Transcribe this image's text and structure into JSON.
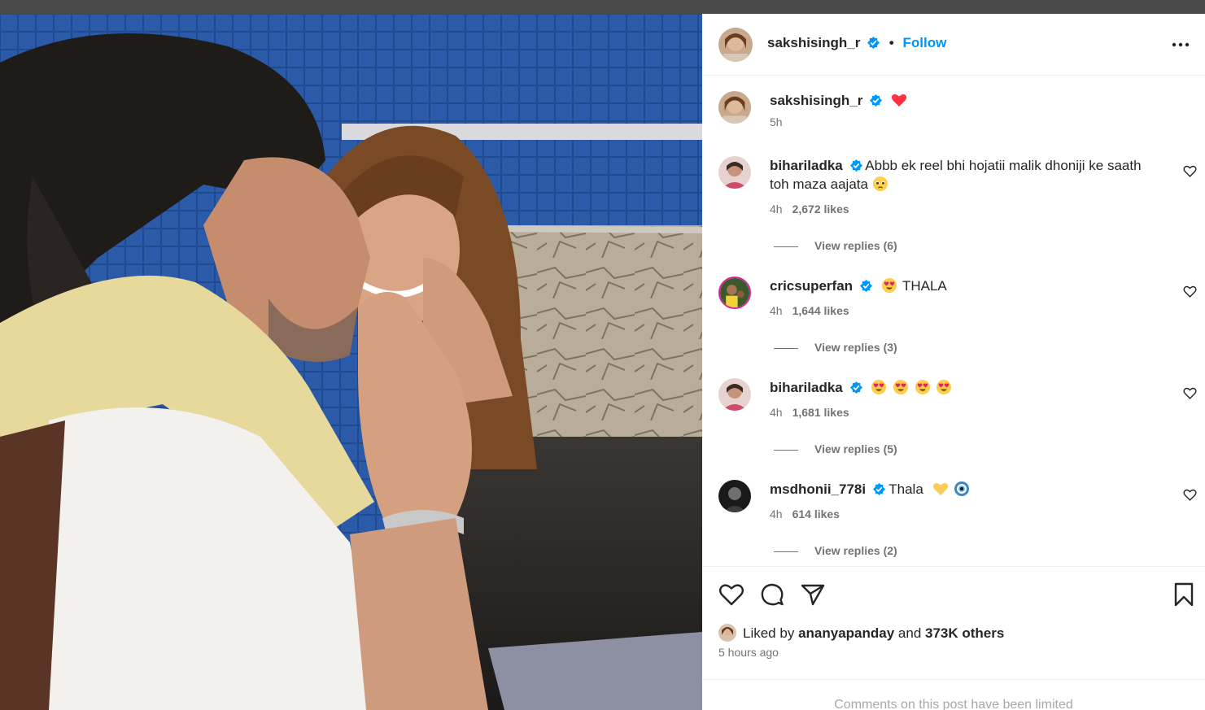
{
  "post": {
    "author": "sakshisingh_r",
    "follow_label": "Follow",
    "caption_time": "5h",
    "likes_prefix": "Liked by",
    "liked_by_user": "ananyapanday",
    "likes_mid": "and",
    "likes_others": "373K others",
    "time_ago": "5 hours ago",
    "comments_limited": "Comments on this post have been limited"
  },
  "comments": [
    {
      "user": "bihariladka",
      "text": "Abbb ek reel bhi hojatii malik dhoniji ke saath toh maza aajata",
      "time": "4h",
      "likes": "2,672 likes",
      "replies": "View replies (6)"
    },
    {
      "user": "cricsuperfan",
      "text": "THALA",
      "time": "4h",
      "likes": "1,644 likes",
      "replies": "View replies (3)"
    },
    {
      "user": "bihariladka",
      "text": "",
      "time": "4h",
      "likes": "1,681 likes",
      "replies": "View replies (5)"
    },
    {
      "user": "msdhonii_778i",
      "text": "Thala",
      "time": "4h",
      "likes": "614 likes",
      "replies": "View replies (2)"
    }
  ],
  "icons": {
    "more": "more-options-icon",
    "like": "heart-icon",
    "comment": "comment-icon",
    "share": "send-icon",
    "save": "bookmark-icon",
    "verified": "verified-badge-icon"
  },
  "colors": {
    "link": "#0095f6",
    "verified": "#0095f6",
    "heart_red": "#ff3040",
    "muted_text": "#737373"
  }
}
